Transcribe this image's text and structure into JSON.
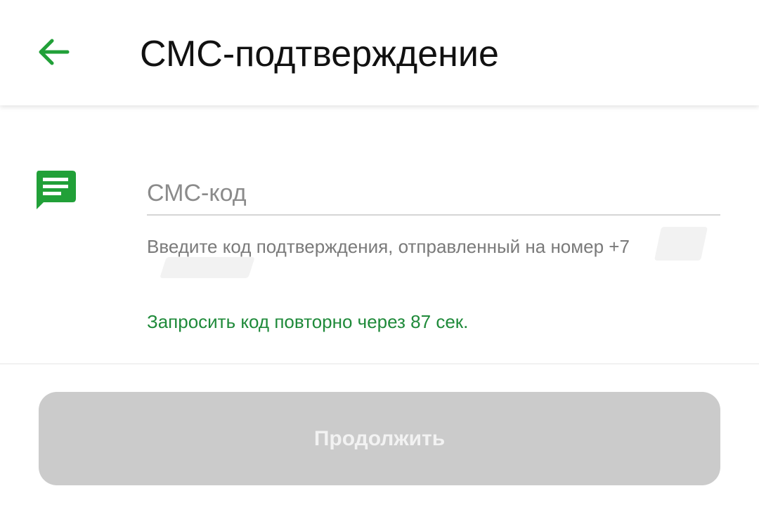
{
  "header": {
    "title": "СМС-подтверждение",
    "back_icon": "arrow-left-icon"
  },
  "form": {
    "icon": "sms-message-icon",
    "code_input": {
      "placeholder": "СМС-код",
      "value": ""
    },
    "hint": "Введите код подтверждения, отправленный на номер +7",
    "resend_text": "Запросить код повторно через 87 сек."
  },
  "continue_button": {
    "label": "Продолжить",
    "enabled": false
  },
  "colors": {
    "accent": "#1f8a3a",
    "icon_green": "#21a038",
    "button_disabled_bg": "#cbcbcb",
    "button_disabled_text": "#f2f2f2",
    "hint_text": "#7a7a7a"
  }
}
